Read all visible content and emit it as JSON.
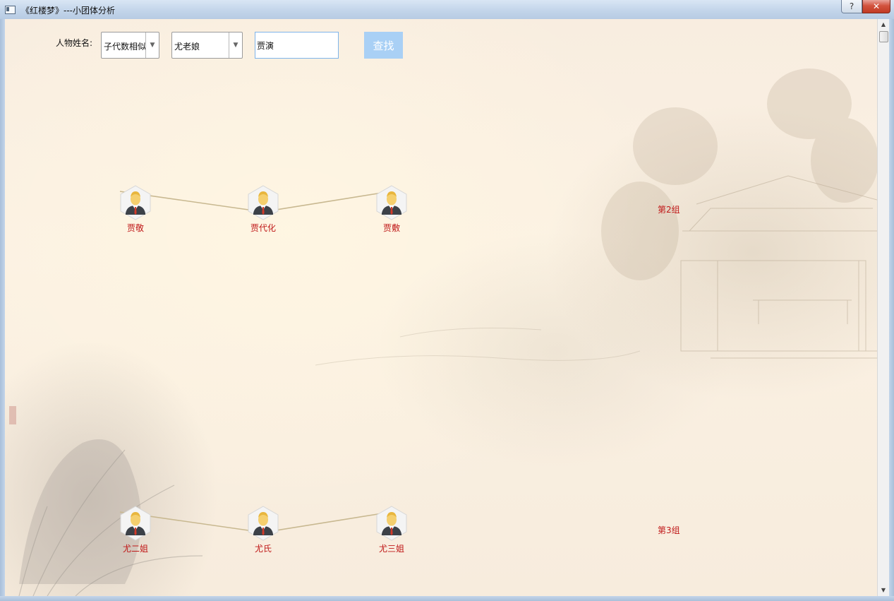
{
  "window": {
    "title": "《红楼梦》---小团体分析",
    "help_glyph": "?",
    "close_glyph": "✕"
  },
  "toolbar": {
    "name_label": "人物姓名:",
    "mode_select": {
      "value": "子代数相似"
    },
    "person_select": {
      "value": "尤老娘"
    },
    "name_input": {
      "value": "贾演"
    },
    "search_label": "查找"
  },
  "groups": [
    {
      "label": "第2组",
      "members": [
        {
          "name": "贾敬"
        },
        {
          "name": "贾代化"
        },
        {
          "name": "贾敷"
        }
      ]
    },
    {
      "label": "第3组",
      "members": [
        {
          "name": "尤二姐"
        },
        {
          "name": "尤氏"
        },
        {
          "name": "尤三姐"
        }
      ]
    }
  ],
  "icons": {
    "avatar": "person-avatar-icon",
    "dropdown": "chevron-down-icon",
    "scroll_up": "▲",
    "scroll_down": "▼"
  },
  "colors": {
    "node_label": "#c01818",
    "edge": "#c8b890",
    "search_button": "#a9d0f5"
  }
}
